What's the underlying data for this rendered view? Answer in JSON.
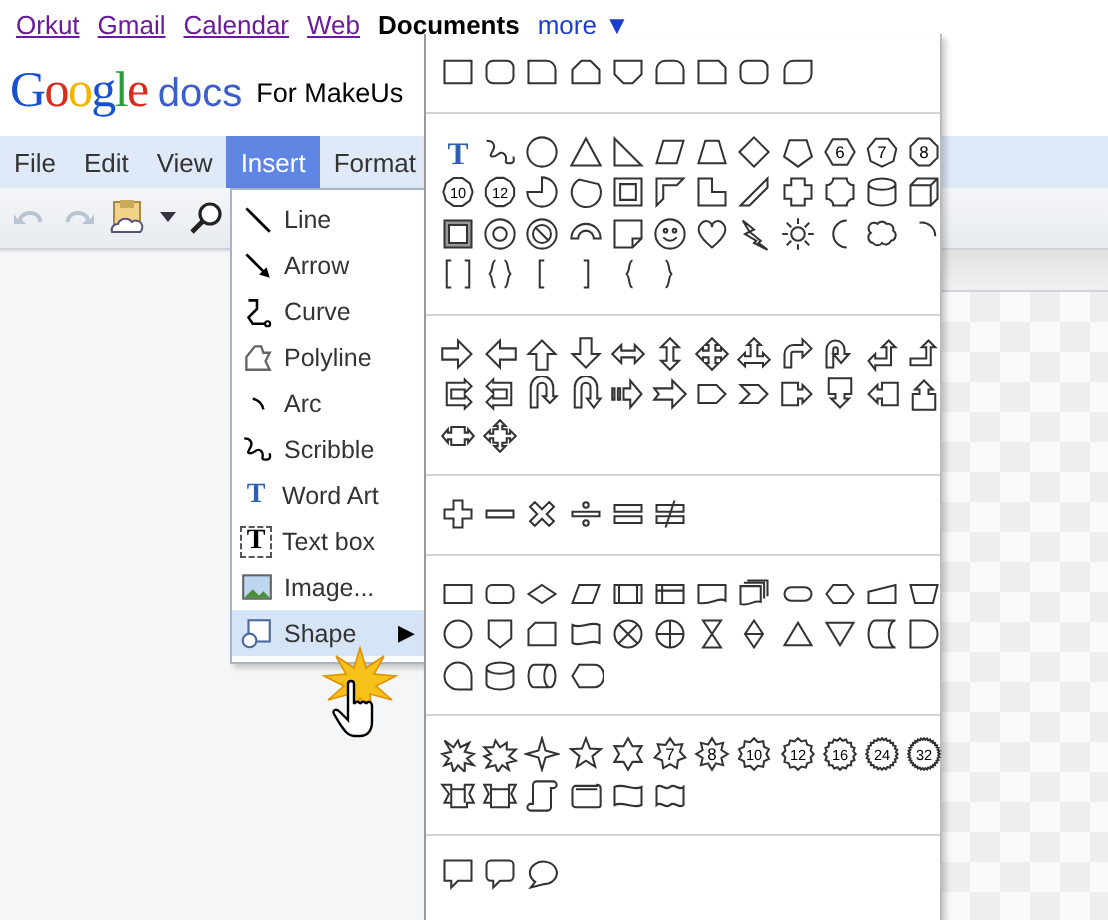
{
  "top_links": [
    {
      "label": "Orkut",
      "current": false
    },
    {
      "label": "Gmail",
      "current": false
    },
    {
      "label": "Calendar",
      "current": false
    },
    {
      "label": "Web",
      "current": false
    },
    {
      "label": "Documents",
      "current": true
    },
    {
      "label": "more ▼",
      "current": false
    }
  ],
  "logo": {
    "brand": "Google",
    "product": "docs"
  },
  "document_title": "For MakeUs",
  "menu_bar": [
    {
      "label": "File",
      "selected": false
    },
    {
      "label": "Edit",
      "selected": false
    },
    {
      "label": "View",
      "selected": false
    },
    {
      "label": "Insert",
      "selected": true
    },
    {
      "label": "Format",
      "selected": false
    }
  ],
  "insert_menu": [
    {
      "kind": "line",
      "label": "Line",
      "selected": false
    },
    {
      "kind": "arrow",
      "label": "Arrow",
      "selected": false
    },
    {
      "kind": "curve",
      "label": "Curve",
      "selected": false
    },
    {
      "kind": "polyline",
      "label": "Polyline",
      "selected": false
    },
    {
      "kind": "arc",
      "label": "Arc",
      "selected": false
    },
    {
      "kind": "scribble",
      "label": "Scribble",
      "selected": false
    },
    {
      "kind": "word-art",
      "label": "Word Art",
      "icon_text": "T",
      "selected": false
    },
    {
      "kind": "text-box",
      "label": "Text box",
      "icon_text": "T",
      "selected": false
    },
    {
      "kind": "image",
      "label": "Image...",
      "selected": false
    },
    {
      "kind": "shape",
      "label": "Shape",
      "submenu": "▶",
      "selected": true
    }
  ],
  "shape_sections": [
    {
      "shapes": [
        {
          "kind": "rectangle"
        },
        {
          "kind": "rounded-rectangle"
        },
        {
          "kind": "rounded-corner-rectangle"
        },
        {
          "kind": "snipped-top-rectangle"
        },
        {
          "kind": "snipped-bottom-rectangle"
        },
        {
          "kind": "rounded-top-rectangle"
        },
        {
          "kind": "snipped-corner-rectangle"
        },
        {
          "kind": "rounded-rectangle"
        },
        {
          "kind": "rounded-diagonal-rectangle"
        }
      ]
    },
    {
      "shapes": [
        {
          "kind": "word-art",
          "label": "T"
        },
        {
          "kind": "scribble"
        },
        {
          "kind": "ellipse"
        },
        {
          "kind": "triangle"
        },
        {
          "kind": "right-triangle"
        },
        {
          "kind": "parallelogram"
        },
        {
          "kind": "trapezoid"
        },
        {
          "kind": "diamond"
        },
        {
          "kind": "pentagon"
        },
        {
          "kind": "hexagon",
          "label": "6"
        },
        {
          "kind": "heptagon",
          "label": "7"
        },
        {
          "kind": "octagon",
          "label": "8"
        },
        {
          "kind": "decagon",
          "label": "10"
        },
        {
          "kind": "dodecagon",
          "label": "12"
        },
        {
          "kind": "pie"
        },
        {
          "kind": "chord"
        },
        {
          "kind": "frame"
        },
        {
          "kind": "half-frame"
        },
        {
          "kind": "l-shape"
        },
        {
          "kind": "diagonal-stripe"
        },
        {
          "kind": "cross"
        },
        {
          "kind": "plaque"
        },
        {
          "kind": "can"
        },
        {
          "kind": "cube"
        },
        {
          "kind": "bevel"
        },
        {
          "kind": "donut"
        },
        {
          "kind": "no-symbol"
        },
        {
          "kind": "block-arc"
        },
        {
          "kind": "folded-corner"
        },
        {
          "kind": "smiley"
        },
        {
          "kind": "heart"
        },
        {
          "kind": "lightning-bolt"
        },
        {
          "kind": "sun"
        },
        {
          "kind": "moon"
        },
        {
          "kind": "cloud"
        },
        {
          "kind": "arc"
        },
        {
          "kind": "bracket-pair"
        },
        {
          "kind": "brace-pair"
        },
        {
          "kind": "left-bracket"
        },
        {
          "kind": "right-bracket"
        },
        {
          "kind": "left-brace"
        },
        {
          "kind": "right-brace"
        }
      ]
    },
    {
      "shapes": [
        {
          "kind": "right-arrow"
        },
        {
          "kind": "left-arrow"
        },
        {
          "kind": "up-arrow"
        },
        {
          "kind": "down-arrow"
        },
        {
          "kind": "left-right-arrow"
        },
        {
          "kind": "up-down-arrow"
        },
        {
          "kind": "quad-arrow"
        },
        {
          "kind": "left-right-up-arrow"
        },
        {
          "kind": "bent-arrow"
        },
        {
          "kind": "u-turn-arrow"
        },
        {
          "kind": "left-up-arrow"
        },
        {
          "kind": "bent-up-arrow"
        },
        {
          "kind": "curved-right-arrow"
        },
        {
          "kind": "curved-left-arrow"
        },
        {
          "kind": "curved-up-arrow"
        },
        {
          "kind": "curved-down-arrow"
        },
        {
          "kind": "striped-right-arrow"
        },
        {
          "kind": "notched-right-arrow"
        },
        {
          "kind": "pentagon-arrow"
        },
        {
          "kind": "chevron-arrow"
        },
        {
          "kind": "right-arrow-callout"
        },
        {
          "kind": "down-arrow-callout"
        },
        {
          "kind": "left-arrow-callout"
        },
        {
          "kind": "up-arrow-callout"
        },
        {
          "kind": "left-right-arrow-callout"
        },
        {
          "kind": "quad-arrow-callout"
        }
      ]
    },
    {
      "shapes": [
        {
          "kind": "plus"
        },
        {
          "kind": "minus"
        },
        {
          "kind": "multiply"
        },
        {
          "kind": "divide"
        },
        {
          "kind": "equal"
        },
        {
          "kind": "not-equal"
        }
      ]
    },
    {
      "shapes": [
        {
          "kind": "process"
        },
        {
          "kind": "alternate-process"
        },
        {
          "kind": "decision"
        },
        {
          "kind": "data"
        },
        {
          "kind": "predefined-process"
        },
        {
          "kind": "internal-storage"
        },
        {
          "kind": "document"
        },
        {
          "kind": "multidocument"
        },
        {
          "kind": "terminator"
        },
        {
          "kind": "preparation"
        },
        {
          "kind": "manual-input"
        },
        {
          "kind": "manual-operation"
        },
        {
          "kind": "connector"
        },
        {
          "kind": "off-page-connector"
        },
        {
          "kind": "card"
        },
        {
          "kind": "punched-tape"
        },
        {
          "kind": "summing-junction"
        },
        {
          "kind": "or"
        },
        {
          "kind": "collate"
        },
        {
          "kind": "sort"
        },
        {
          "kind": "extract"
        },
        {
          "kind": "merge"
        },
        {
          "kind": "stored-data"
        },
        {
          "kind": "delay"
        },
        {
          "kind": "sequential-access-storage"
        },
        {
          "kind": "magnetic-disk"
        },
        {
          "kind": "direct-access-storage"
        },
        {
          "kind": "display"
        }
      ]
    },
    {
      "shapes": [
        {
          "kind": "explosion"
        },
        {
          "kind": "explosion-two"
        },
        {
          "kind": "four-point-star"
        },
        {
          "kind": "five-point-star"
        },
        {
          "kind": "six-point-star"
        },
        {
          "kind": "seven-point-star",
          "label": "7"
        },
        {
          "kind": "eight-point-star",
          "label": "8"
        },
        {
          "kind": "ten-point-star",
          "label": "10"
        },
        {
          "kind": "twelve-point-star",
          "label": "12"
        },
        {
          "kind": "sixteen-point-star",
          "label": "16"
        },
        {
          "kind": "twenty-four-point-star",
          "label": "24"
        },
        {
          "kind": "thirty-two-point-star",
          "label": "32"
        },
        {
          "kind": "down-ribbon"
        },
        {
          "kind": "up-ribbon"
        },
        {
          "kind": "vertical-scroll"
        },
        {
          "kind": "horizontal-scroll"
        },
        {
          "kind": "wave"
        },
        {
          "kind": "double-wave"
        }
      ]
    },
    {
      "shapes": [
        {
          "kind": "rectangular-callout"
        },
        {
          "kind": "rounded-callout"
        },
        {
          "kind": "oval-callout"
        }
      ]
    }
  ]
}
